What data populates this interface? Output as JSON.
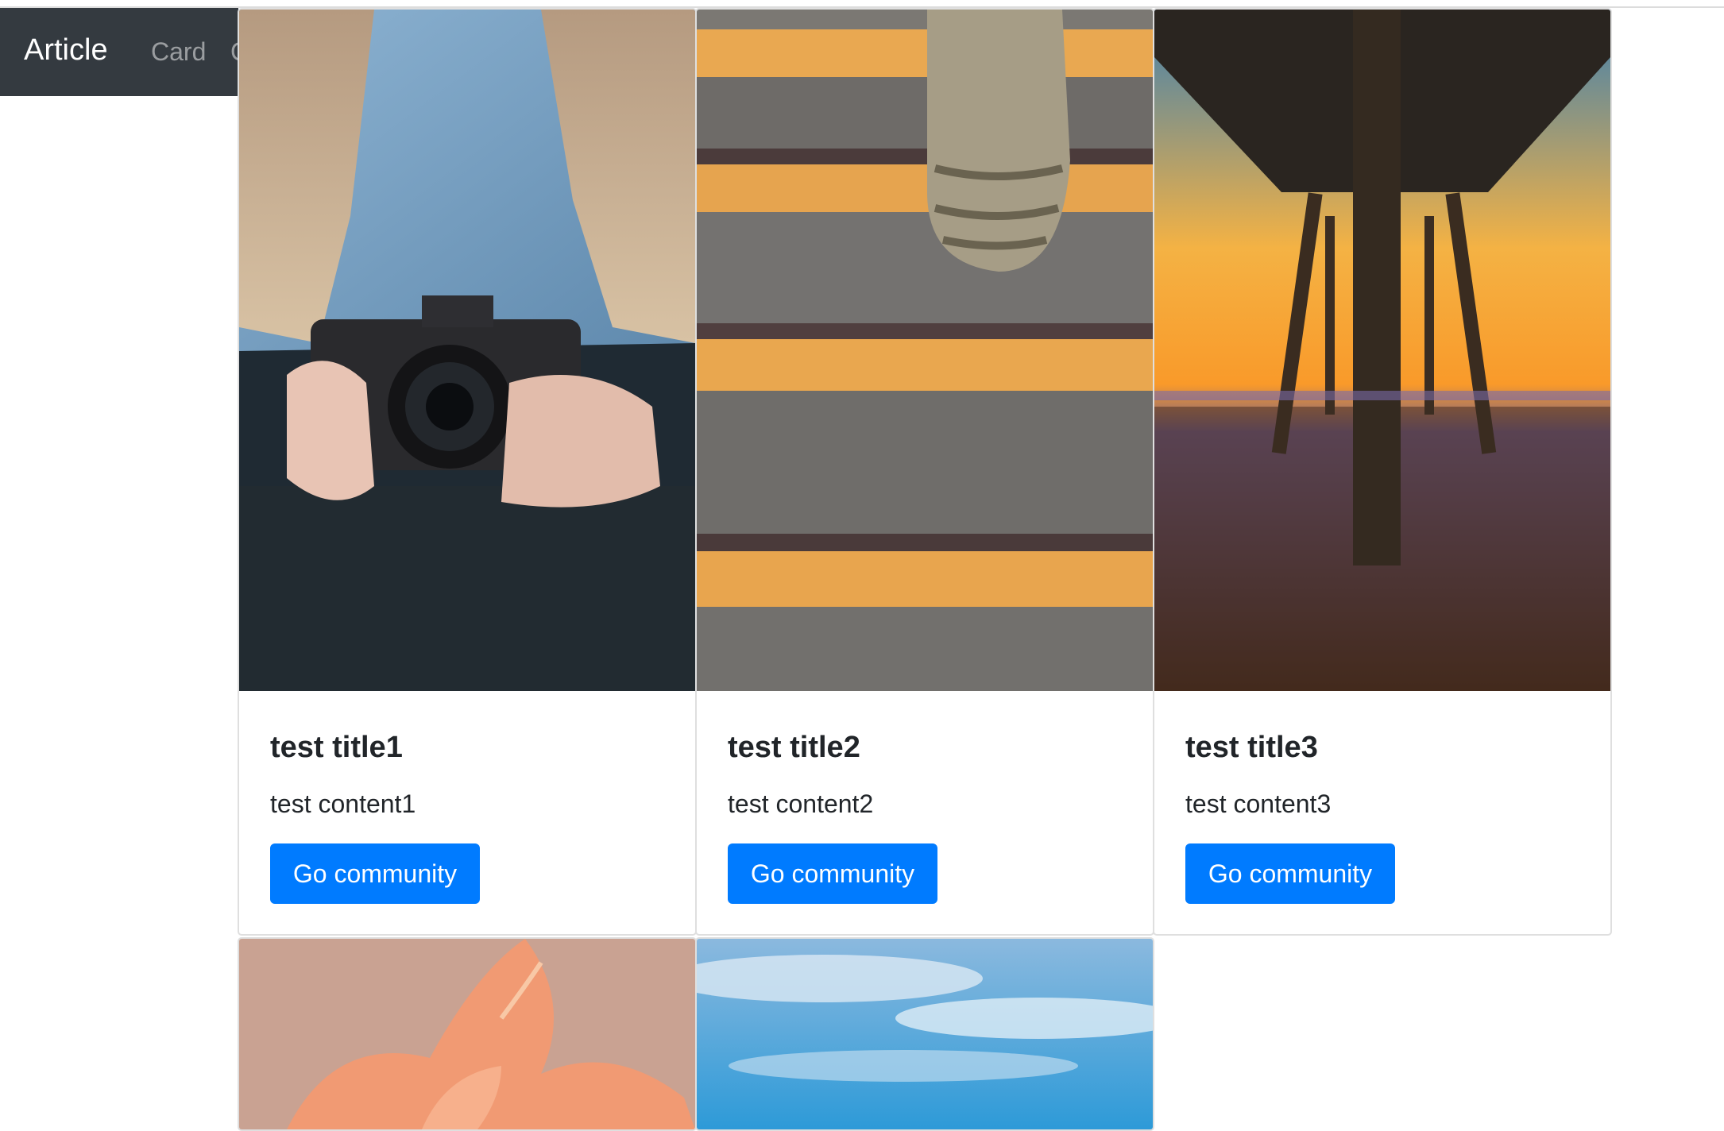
{
  "navbar": {
    "brand": "Article",
    "links": [
      "Card",
      "C"
    ]
  },
  "cards": [
    {
      "title": "test title1",
      "content": "test content1",
      "button": "Go community",
      "image": "woman-holding-camera"
    },
    {
      "title": "test title2",
      "content": "test content2",
      "button": "Go community",
      "image": "shoe-on-stairs"
    },
    {
      "title": "test title3",
      "content": "test content3",
      "button": "Go community",
      "image": "pier-at-sunset"
    },
    {
      "image": "orange-flower"
    },
    {
      "image": "blue-sky-clouds"
    }
  ],
  "colors": {
    "navbar_bg": "#343a40",
    "button_bg": "#007bff",
    "text": "#212529"
  }
}
